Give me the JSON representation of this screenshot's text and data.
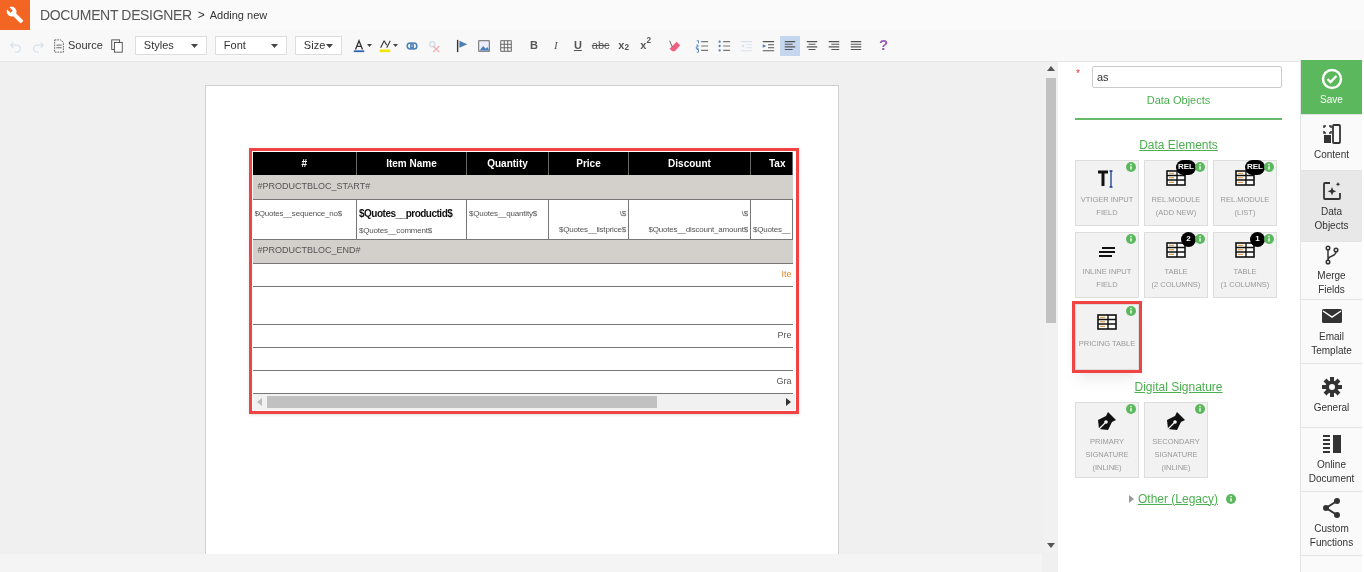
{
  "header": {
    "title": "DOCUMENT DESIGNER",
    "separator": ">",
    "subtitle": "Adding new"
  },
  "toolbar": [
    {
      "kind": "undo",
      "disabled": true
    },
    {
      "kind": "redo",
      "disabled": true
    },
    {
      "kind": "source",
      "label": "Source",
      "disabled": false
    },
    {
      "kind": "copy",
      "disabled": false
    },
    {
      "kind": "dropdown",
      "label": "Styles",
      "disabled": false
    },
    {
      "kind": "dropdown",
      "label": "Font",
      "disabled": false
    },
    {
      "kind": "dropdown",
      "label": "Size",
      "disabled": false
    },
    {
      "kind": "text-color",
      "disabled": false
    },
    {
      "kind": "highlight",
      "disabled": false
    },
    {
      "kind": "link",
      "disabled": false
    },
    {
      "kind": "unlink",
      "disabled": true
    },
    {
      "kind": "anchor",
      "disabled": false
    },
    {
      "kind": "image",
      "disabled": false
    },
    {
      "kind": "table",
      "disabled": false
    },
    {
      "kind": "glyph",
      "label": "B",
      "disabled": false
    },
    {
      "kind": "glyph",
      "label": "I",
      "disabled": false
    },
    {
      "kind": "glyph",
      "label": "U",
      "disabled": false
    },
    {
      "kind": "glyph",
      "label": "abc",
      "disabled": false
    },
    {
      "kind": "glyph",
      "label": "x$_{2}$",
      "disabled": false
    },
    {
      "kind": "glyph",
      "label": "x$^{2}$",
      "disabled": false
    },
    {
      "kind": "eraser",
      "disabled": false
    },
    {
      "kind": "numbered-list",
      "disabled": false
    },
    {
      "kind": "bulleted-list",
      "disabled": false
    },
    {
      "kind": "outdent",
      "disabled": true
    },
    {
      "kind": "indent",
      "disabled": false
    },
    {
      "kind": "align-left",
      "disabled": false,
      "selected": true
    },
    {
      "kind": "align-center",
      "disabled": false,
      "selected": false
    },
    {
      "kind": "align-right",
      "disabled": false,
      "selected": false
    },
    {
      "kind": "justify",
      "disabled": false,
      "selected": false
    },
    {
      "kind": "help",
      "label": "?",
      "disabled": false
    }
  ],
  "table": {
    "columns": [
      "#",
      "Item Name",
      "Quantity",
      "Price",
      "Discount",
      "Tax"
    ],
    "rows": [
      {
        "kind": "marker",
        "text": "#PRODUCTBLOC_START#"
      },
      {
        "kind": "item",
        "cells": [
          [
            "$Quotes__sequence_no$"
          ],
          [
            "$Quotes__productid$",
            "$Quotes__comment$"
          ],
          [
            "$Quotes__quantity$"
          ],
          [
            "\\$",
            "$Quotes__listprice$"
          ],
          [
            "\\$",
            "$Quotes__discount_amount$"
          ],
          [
            "$Quotes__"
          ]
        ]
      },
      {
        "kind": "marker",
        "text": "#PRODUCTBLOC_END#"
      },
      {
        "kind": "total",
        "text": "Ite",
        "accent": true
      },
      {
        "kind": "blank"
      },
      {
        "kind": "total",
        "text": "Pre",
        "accent": false
      },
      {
        "kind": "total",
        "text": ""
      },
      {
        "kind": "total",
        "text": "Gra",
        "accent": false
      }
    ]
  },
  "panel": {
    "required_mark": "*",
    "search": {
      "value": "as"
    },
    "tab": "Data Objects",
    "sections": [
      {
        "title": "Data Elements",
        "tiles": [
          {
            "kind": "text-input",
            "lines": [
              "VTIGER INPUT",
              "FIELD"
            ],
            "highlighted": false
          },
          {
            "kind": "rel-module",
            "lines": [
              "REL.MODULE",
              "(ADD NEW)"
            ],
            "badge": "REL",
            "highlighted": false
          },
          {
            "kind": "rel-module",
            "lines": [
              "REL.MODULE",
              "(LIST)"
            ],
            "badge": "REL",
            "highlighted": false
          },
          {
            "kind": "inline-input",
            "lines": [
              "INLINE INPUT",
              "FIELD"
            ],
            "highlighted": false
          },
          {
            "kind": "table",
            "lines": [
              "TABLE",
              "(2 COLUMNS)"
            ],
            "badge": "2",
            "highlighted": false
          },
          {
            "kind": "table",
            "lines": [
              "TABLE",
              "(1 COLUMNS)"
            ],
            "badge": "1",
            "highlighted": false
          },
          {
            "kind": "pricing-table",
            "lines": [
              "PRICING TABLE"
            ],
            "highlighted": true
          }
        ]
      },
      {
        "title": "Digital Signature",
        "tiles": [
          {
            "kind": "signature",
            "lines": [
              "PRIMARY",
              "SIGNATURE",
              "(INLINE)"
            ],
            "highlighted": false
          },
          {
            "kind": "signature",
            "lines": [
              "SECONDARY",
              "SIGNATURE",
              "(INLINE)"
            ],
            "highlighted": false
          }
        ]
      }
    ],
    "other": {
      "title": "Other (Legacy)",
      "expanded": false
    }
  },
  "sidebar": [
    {
      "kind": "check",
      "label": "Save",
      "selected": false
    },
    {
      "kind": "panels",
      "label": "Content",
      "selected": false
    },
    {
      "kind": "sparkle",
      "label": "Data Objects",
      "selected": true
    },
    {
      "kind": "branch",
      "label": "Merge Fields",
      "selected": false
    },
    {
      "kind": "envelope",
      "label": "Email Template",
      "selected": false
    },
    {
      "kind": "gear",
      "label": "General",
      "selected": false
    },
    {
      "kind": "document",
      "label": "Online Document",
      "selected": false
    },
    {
      "kind": "share",
      "label": "Custom Functions",
      "selected": false
    }
  ]
}
